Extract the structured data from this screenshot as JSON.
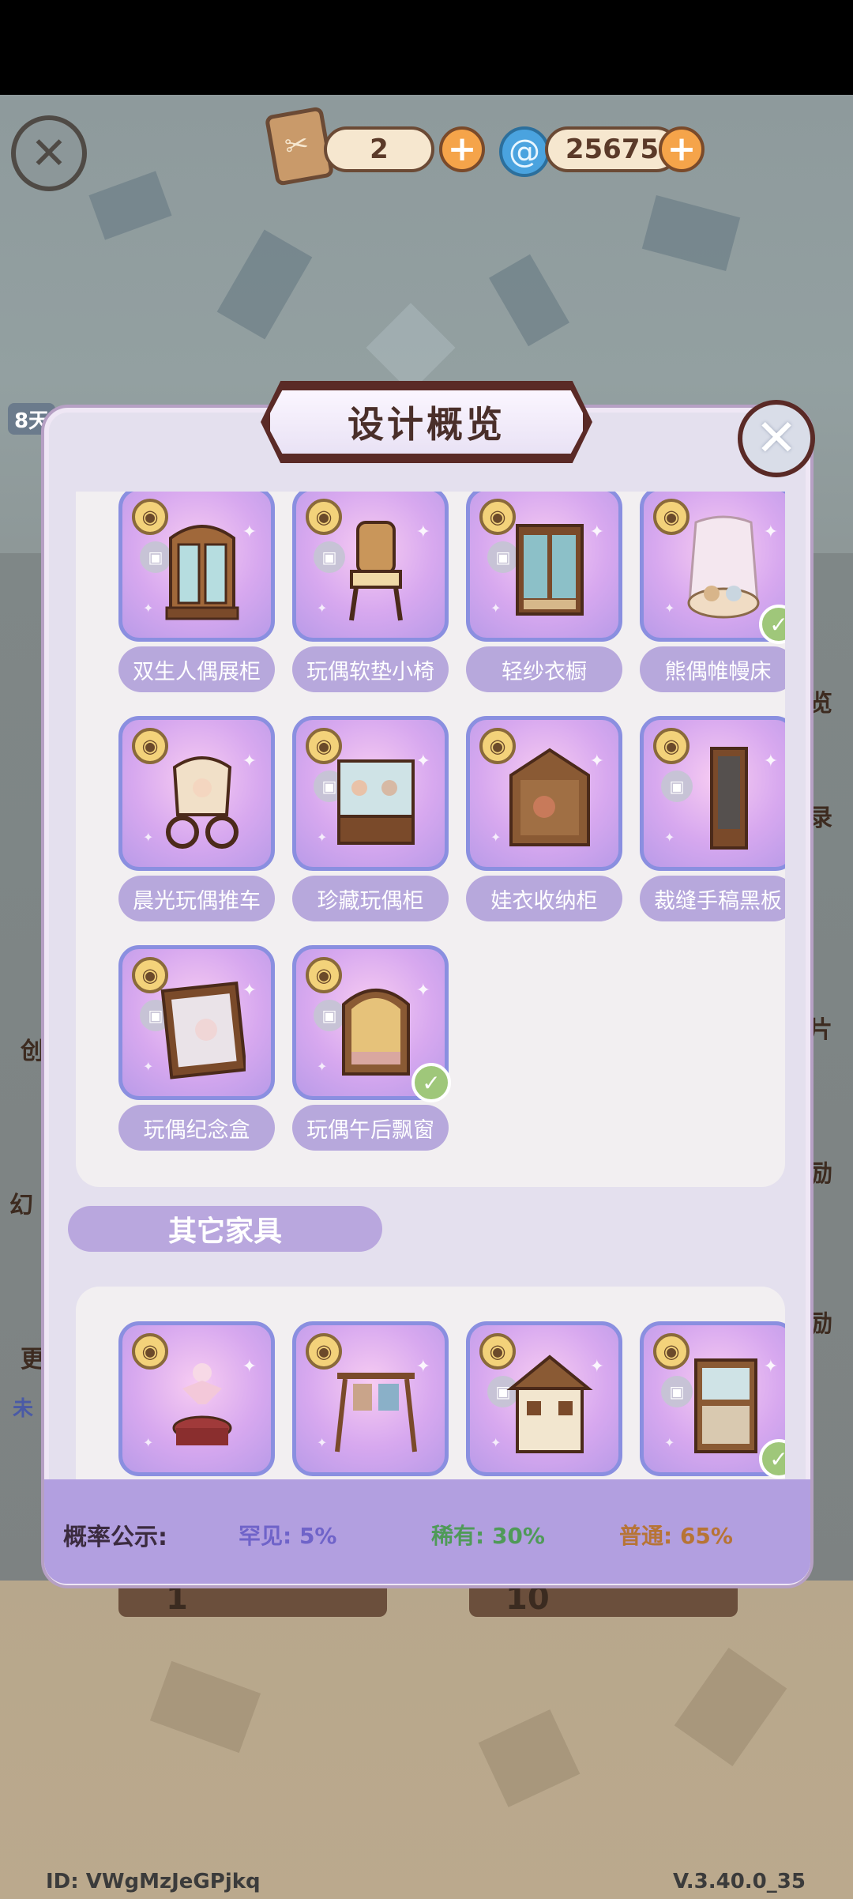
{
  "top_bar": {
    "ticket_count": "2",
    "crystal_count": "25675"
  },
  "side": {
    "badge": "8天",
    "right_frag": [
      "览",
      "录",
      "片",
      "励",
      "励"
    ],
    "left_frag": [
      "创",
      "幻",
      "更",
      "未"
    ]
  },
  "modal": {
    "title": "设计概览",
    "section_other": "其它家具",
    "items_main": [
      {
        "label": "双生人偶展柜",
        "owned": false
      },
      {
        "label": "玩偶软垫小椅",
        "owned": false
      },
      {
        "label": "轻纱衣橱",
        "owned": false
      },
      {
        "label": "熊偶帷幔床",
        "owned": true
      },
      {
        "label": "晨光玩偶推车",
        "owned": false
      },
      {
        "label": "珍藏玩偶柜",
        "owned": false
      },
      {
        "label": "娃衣收纳柜",
        "owned": false
      },
      {
        "label": "裁缝手稿黑板",
        "owned": false
      },
      {
        "label": "玩偶纪念盒",
        "owned": false
      },
      {
        "label": "玩偶午后飘窗",
        "owned": true
      }
    ],
    "items_other": [
      {
        "owned": false
      },
      {
        "owned": false
      },
      {
        "owned": false
      },
      {
        "owned": true
      }
    ]
  },
  "probability": {
    "title": "概率公示:",
    "rare": "罕见: 5%",
    "uncommon": "稀有: 30%",
    "common": "普通: 65%",
    "colors": {
      "rare": "#6f63c9",
      "uncommon": "#4f9a58",
      "common": "#b77435"
    }
  },
  "bottom": {
    "left_num": "1",
    "right_num": "10"
  },
  "footer": {
    "id": "ID: VWgMzJeGPjkq",
    "version": "V.3.40.0_35"
  }
}
